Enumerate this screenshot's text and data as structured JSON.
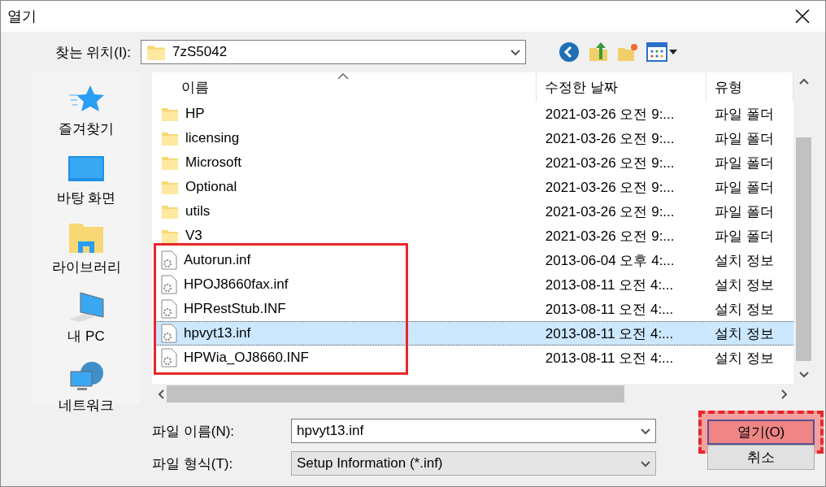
{
  "window": {
    "title": "열기"
  },
  "look_in": {
    "label": "찾는 위치(I):",
    "value": "7zS5042"
  },
  "sidebar": {
    "items": [
      {
        "label": "즐겨찾기"
      },
      {
        "label": "바탕 화면"
      },
      {
        "label": "라이브러리"
      },
      {
        "label": "내 PC"
      },
      {
        "label": "네트워크"
      }
    ]
  },
  "columns": [
    {
      "label": "이름",
      "sorted": true
    },
    {
      "label": "수정한 날짜"
    },
    {
      "label": "유형"
    }
  ],
  "files": [
    {
      "kind": "folder",
      "name": "HP",
      "date": "2021-03-26 오전 9:...",
      "type": "파일 폴더",
      "selected": false,
      "highlighted": false
    },
    {
      "kind": "folder",
      "name": "licensing",
      "date": "2021-03-26 오전 9:...",
      "type": "파일 폴더",
      "selected": false,
      "highlighted": false
    },
    {
      "kind": "folder",
      "name": "Microsoft",
      "date": "2021-03-26 오전 9:...",
      "type": "파일 폴더",
      "selected": false,
      "highlighted": false
    },
    {
      "kind": "folder",
      "name": "Optional",
      "date": "2021-03-26 오전 9:...",
      "type": "파일 폴더",
      "selected": false,
      "highlighted": false
    },
    {
      "kind": "folder",
      "name": "utils",
      "date": "2021-03-26 오전 9:...",
      "type": "파일 폴더",
      "selected": false,
      "highlighted": false
    },
    {
      "kind": "folder",
      "name": "V3",
      "date": "2021-03-26 오전 9:...",
      "type": "파일 폴더",
      "selected": false,
      "highlighted": false
    },
    {
      "kind": "setup",
      "name": "Autorun.inf",
      "date": "2013-06-04 오후 4:...",
      "type": "설치 정보",
      "selected": false,
      "highlighted": true
    },
    {
      "kind": "setup",
      "name": "HPOJ8660fax.inf",
      "date": "2013-08-11 오전 4:...",
      "type": "설치 정보",
      "selected": false,
      "highlighted": true
    },
    {
      "kind": "setup",
      "name": "HPRestStub.INF",
      "date": "2013-08-11 오전 4:...",
      "type": "설치 정보",
      "selected": false,
      "highlighted": true
    },
    {
      "kind": "setup",
      "name": "hpvyt13.inf",
      "date": "2013-08-11 오전 4:...",
      "type": "설치 정보",
      "selected": true,
      "highlighted": true
    },
    {
      "kind": "setup",
      "name": "HPWia_OJ8660.INF",
      "date": "2013-08-11 오전 4:...",
      "type": "설치 정보",
      "selected": false,
      "highlighted": true
    }
  ],
  "file_name": {
    "label": "파일 이름(N):",
    "value": "hpvyt13.inf"
  },
  "file_type": {
    "label": "파일 형식(T):",
    "value": "Setup Information (*.inf)"
  },
  "buttons": [
    {
      "label": "열기(O)",
      "primary": true,
      "highlighted": true
    },
    {
      "label": "취소",
      "primary": false,
      "highlighted": false
    }
  ]
}
